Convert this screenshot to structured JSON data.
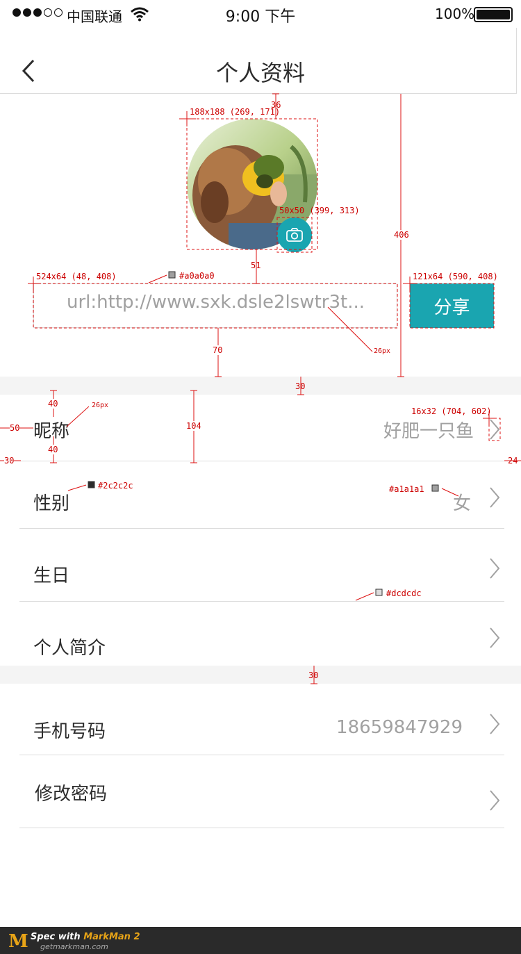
{
  "status_bar": {
    "carrier": "中国联通",
    "time": "9:00 下午",
    "battery": "100%"
  },
  "nav": {
    "title": "个人资料",
    "back_icon": "chevron-left-icon"
  },
  "avatar": {
    "camera_icon": "camera-icon"
  },
  "share_bar": {
    "url": "url:http://www.sxk.dsle2lswtr3t...",
    "share_label": "分享"
  },
  "profile_rows": [
    {
      "label": "昵称",
      "value": "好肥一只鱼"
    },
    {
      "label": "性别",
      "value": "女"
    },
    {
      "label": "生日",
      "value": ""
    },
    {
      "label": "个人简介",
      "value": ""
    }
  ],
  "account_rows": [
    {
      "label": "手机号码",
      "value": "18659847929"
    },
    {
      "label": "修改密码",
      "value": ""
    }
  ],
  "colors": {
    "accent": "#1aa5b0",
    "text_primary": "#2c2c2c",
    "text_secondary": "#a1a1a1",
    "placeholder": "#a0a0a0",
    "divider": "#dcdcdc"
  },
  "spec_annotations": {
    "avatar_size": "188x188 (269, 171)",
    "avatar_top_gap": "36",
    "camera_size": "50x50 (399, 313)",
    "avatar_gap": "51",
    "url_size": "524x64 (48, 408)",
    "url_color": "#a0a0a0",
    "share_size": "121x64 (590, 408)",
    "header_height": "406",
    "font_size_url": "26px",
    "url_gap": "70",
    "band_1": "30",
    "row_pad_top": "40",
    "font_size_row": "26px",
    "row_left": "50",
    "row_pad_bottom": "40",
    "row_height": "104",
    "divider_left": "30",
    "chev_size": "16x32 (704, 602)",
    "right_margin": "24",
    "label_color": "#2c2c2c",
    "value_color": "#a1a1a1",
    "divider_color": "#dcdcdc",
    "band_2": "30"
  },
  "footer": {
    "logo": "M",
    "spec_text_1": "Spec with ",
    "spec_text_2": "MarkMan 2",
    "url": "getmarkman.com"
  }
}
